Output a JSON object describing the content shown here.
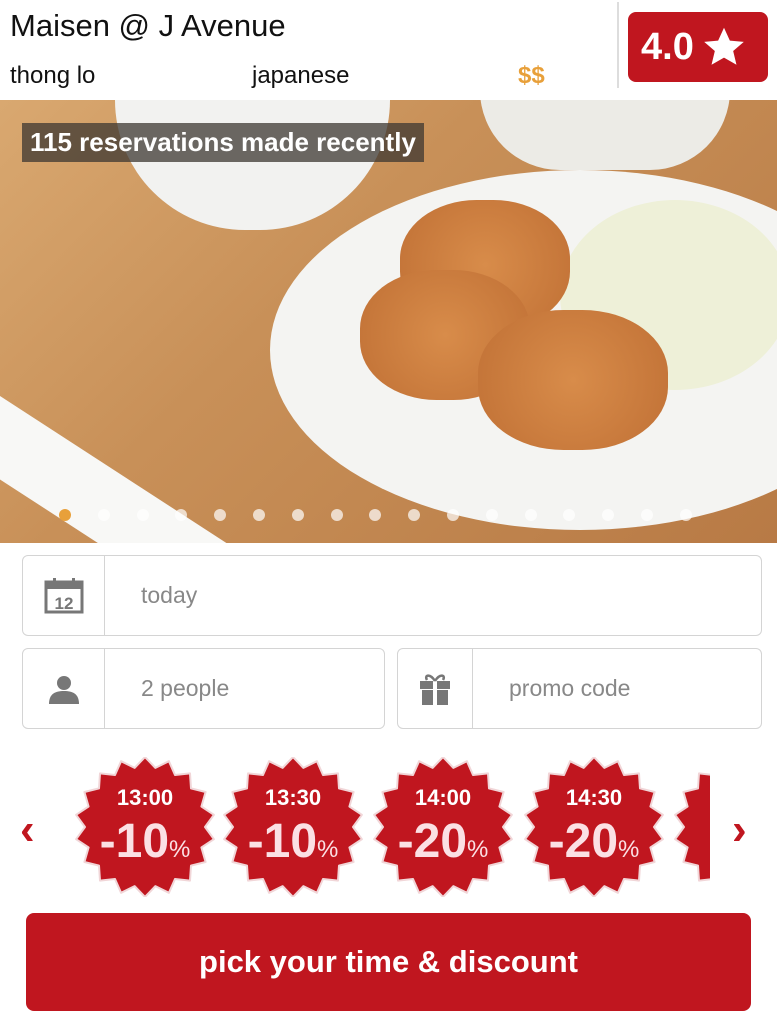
{
  "restaurant": {
    "name": "Maisen @ J Avenue",
    "area": "thong lo",
    "cuisine": "japanese",
    "price": "$$",
    "rating": "4.0"
  },
  "photo": {
    "caption": "115 reservations made recently",
    "carousel_total": 17,
    "carousel_active": 1
  },
  "form": {
    "date": "today",
    "people": "2  people",
    "promo_placeholder": "promo code",
    "calendar_day": "12"
  },
  "slots": [
    {
      "time": "13:00",
      "discount": "-10",
      "unit": "%"
    },
    {
      "time": "13:30",
      "discount": "-10",
      "unit": "%"
    },
    {
      "time": "14:00",
      "discount": "-20",
      "unit": "%"
    },
    {
      "time": "14:30",
      "discount": "-20",
      "unit": "%"
    },
    {
      "time": "",
      "discount": "-",
      "unit": ""
    }
  ],
  "nav": {
    "prev": "‹",
    "next": "›"
  },
  "cta": "pick your time & discount",
  "colors": {
    "brand": "#c0161f",
    "price": "#e8a03a",
    "active_dot": "#e8a03a"
  }
}
